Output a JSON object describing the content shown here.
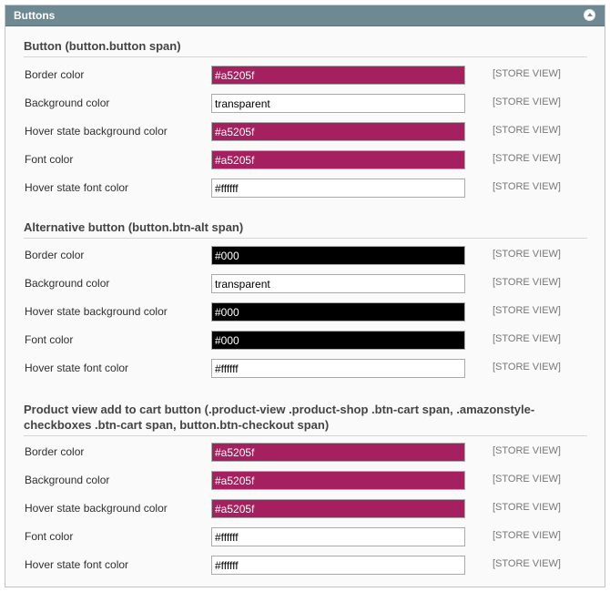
{
  "panel": {
    "title": "Buttons"
  },
  "scope_label": "[STORE VIEW]",
  "sections": [
    {
      "title": "Button (button.button span)",
      "rows": [
        {
          "label": "Border color",
          "value": "#a5205f",
          "bg": "#a5205f",
          "fg": "#ffffff"
        },
        {
          "label": "Background color",
          "value": "transparent",
          "bg": "#ffffff",
          "fg": "#000000"
        },
        {
          "label": "Hover state background color",
          "value": "#a5205f",
          "bg": "#a5205f",
          "fg": "#ffffff"
        },
        {
          "label": "Font color",
          "value": "#a5205f",
          "bg": "#a5205f",
          "fg": "#ffffff"
        },
        {
          "label": "Hover state font color",
          "value": "#ffffff",
          "bg": "#ffffff",
          "fg": "#000000"
        }
      ]
    },
    {
      "title": "Alternative button (button.btn-alt span)",
      "rows": [
        {
          "label": "Border color",
          "value": "#000",
          "bg": "#000000",
          "fg": "#ffffff"
        },
        {
          "label": "Background color",
          "value": "transparent",
          "bg": "#ffffff",
          "fg": "#000000"
        },
        {
          "label": "Hover state background color",
          "value": "#000",
          "bg": "#000000",
          "fg": "#ffffff"
        },
        {
          "label": "Font color",
          "value": "#000",
          "bg": "#000000",
          "fg": "#ffffff"
        },
        {
          "label": "Hover state font color",
          "value": "#ffffff",
          "bg": "#ffffff",
          "fg": "#000000"
        }
      ]
    },
    {
      "title_line1": "Product view add to cart button (.product-view .product-shop .btn-cart span, .amazonstyle-",
      "title_line2": "checkboxes .btn-cart span, button.btn-checkout span)",
      "rows": [
        {
          "label": "Border color",
          "value": "#a5205f",
          "bg": "#a5205f",
          "fg": "#ffffff"
        },
        {
          "label": "Background color",
          "value": "#a5205f",
          "bg": "#a5205f",
          "fg": "#ffffff"
        },
        {
          "label": "Hover state background color",
          "value": "#a5205f",
          "bg": "#a5205f",
          "fg": "#ffffff"
        },
        {
          "label": "Font color",
          "value": "#ffffff",
          "bg": "#ffffff",
          "fg": "#000000"
        },
        {
          "label": "Hover state font color",
          "value": "#ffffff",
          "bg": "#ffffff",
          "fg": "#000000"
        }
      ]
    }
  ]
}
